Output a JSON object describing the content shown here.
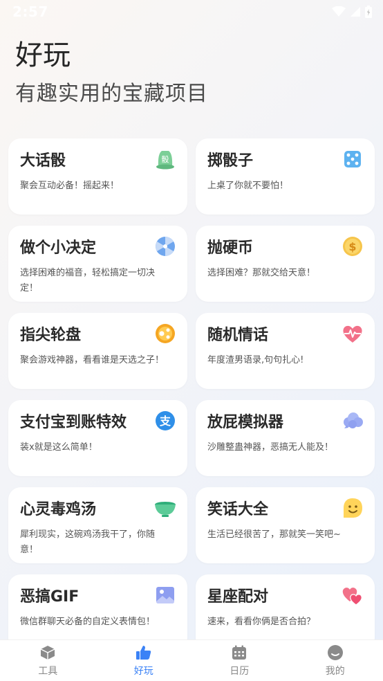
{
  "status_bar": {
    "time": "2:57"
  },
  "header": {
    "title": "好玩",
    "subtitle": "有趣实用的宝藏项目"
  },
  "cards": [
    {
      "title": "大话骰",
      "desc": "聚会互动必备！摇起来！",
      "icon": "dice-cup-icon",
      "icon_text": "骰"
    },
    {
      "title": "掷骰子",
      "desc": "上桌了你就不要怕！",
      "icon": "dice-icon"
    },
    {
      "title": "做个小决定",
      "desc": "选择困难的福音，轻松搞定一切决定！",
      "icon": "spinner-wheel-icon"
    },
    {
      "title": "抛硬币",
      "desc": "选择困难？那就交给天意！",
      "icon": "coin-icon",
      "icon_text": "$"
    },
    {
      "title": "指尖轮盘",
      "desc": "聚会游戏神器，看看谁是天选之子！",
      "icon": "finger-roulette-icon"
    },
    {
      "title": "随机情话",
      "desc": "年度渣男语录,句句扎心!",
      "icon": "heartbeat-icon"
    },
    {
      "title": "支付宝到账特效",
      "desc": "装x就是这么简单！",
      "icon": "alipay-icon",
      "icon_text": "支"
    },
    {
      "title": "放屁模拟器",
      "desc": "沙雕整蛊神器，恶搞无人能及！",
      "icon": "cloud-icon"
    },
    {
      "title": "心灵毒鸡汤",
      "desc": "犀利现实，这碗鸡汤我干了，你随意！",
      "icon": "soup-bowl-icon"
    },
    {
      "title": "笑话大全",
      "desc": "生活已经很苦了，那就笑一笑吧~",
      "icon": "smile-face-icon"
    },
    {
      "title": "恶搞GIF",
      "desc": "微信群聊天必备的自定义表情包！",
      "icon": "image-icon"
    },
    {
      "title": "星座配对",
      "desc": "速来，看看你俩是否合拍？",
      "icon": "double-heart-icon"
    }
  ],
  "tabs": [
    {
      "label": "工具",
      "icon": "cube-icon",
      "active": false
    },
    {
      "label": "好玩",
      "icon": "thumbs-up-icon",
      "active": true
    },
    {
      "label": "日历",
      "icon": "calendar-icon",
      "active": false
    },
    {
      "label": "我的",
      "icon": "profile-icon",
      "active": false
    }
  ],
  "colors": {
    "accent": "#3b82f6",
    "inactive_tab": "#888888"
  }
}
